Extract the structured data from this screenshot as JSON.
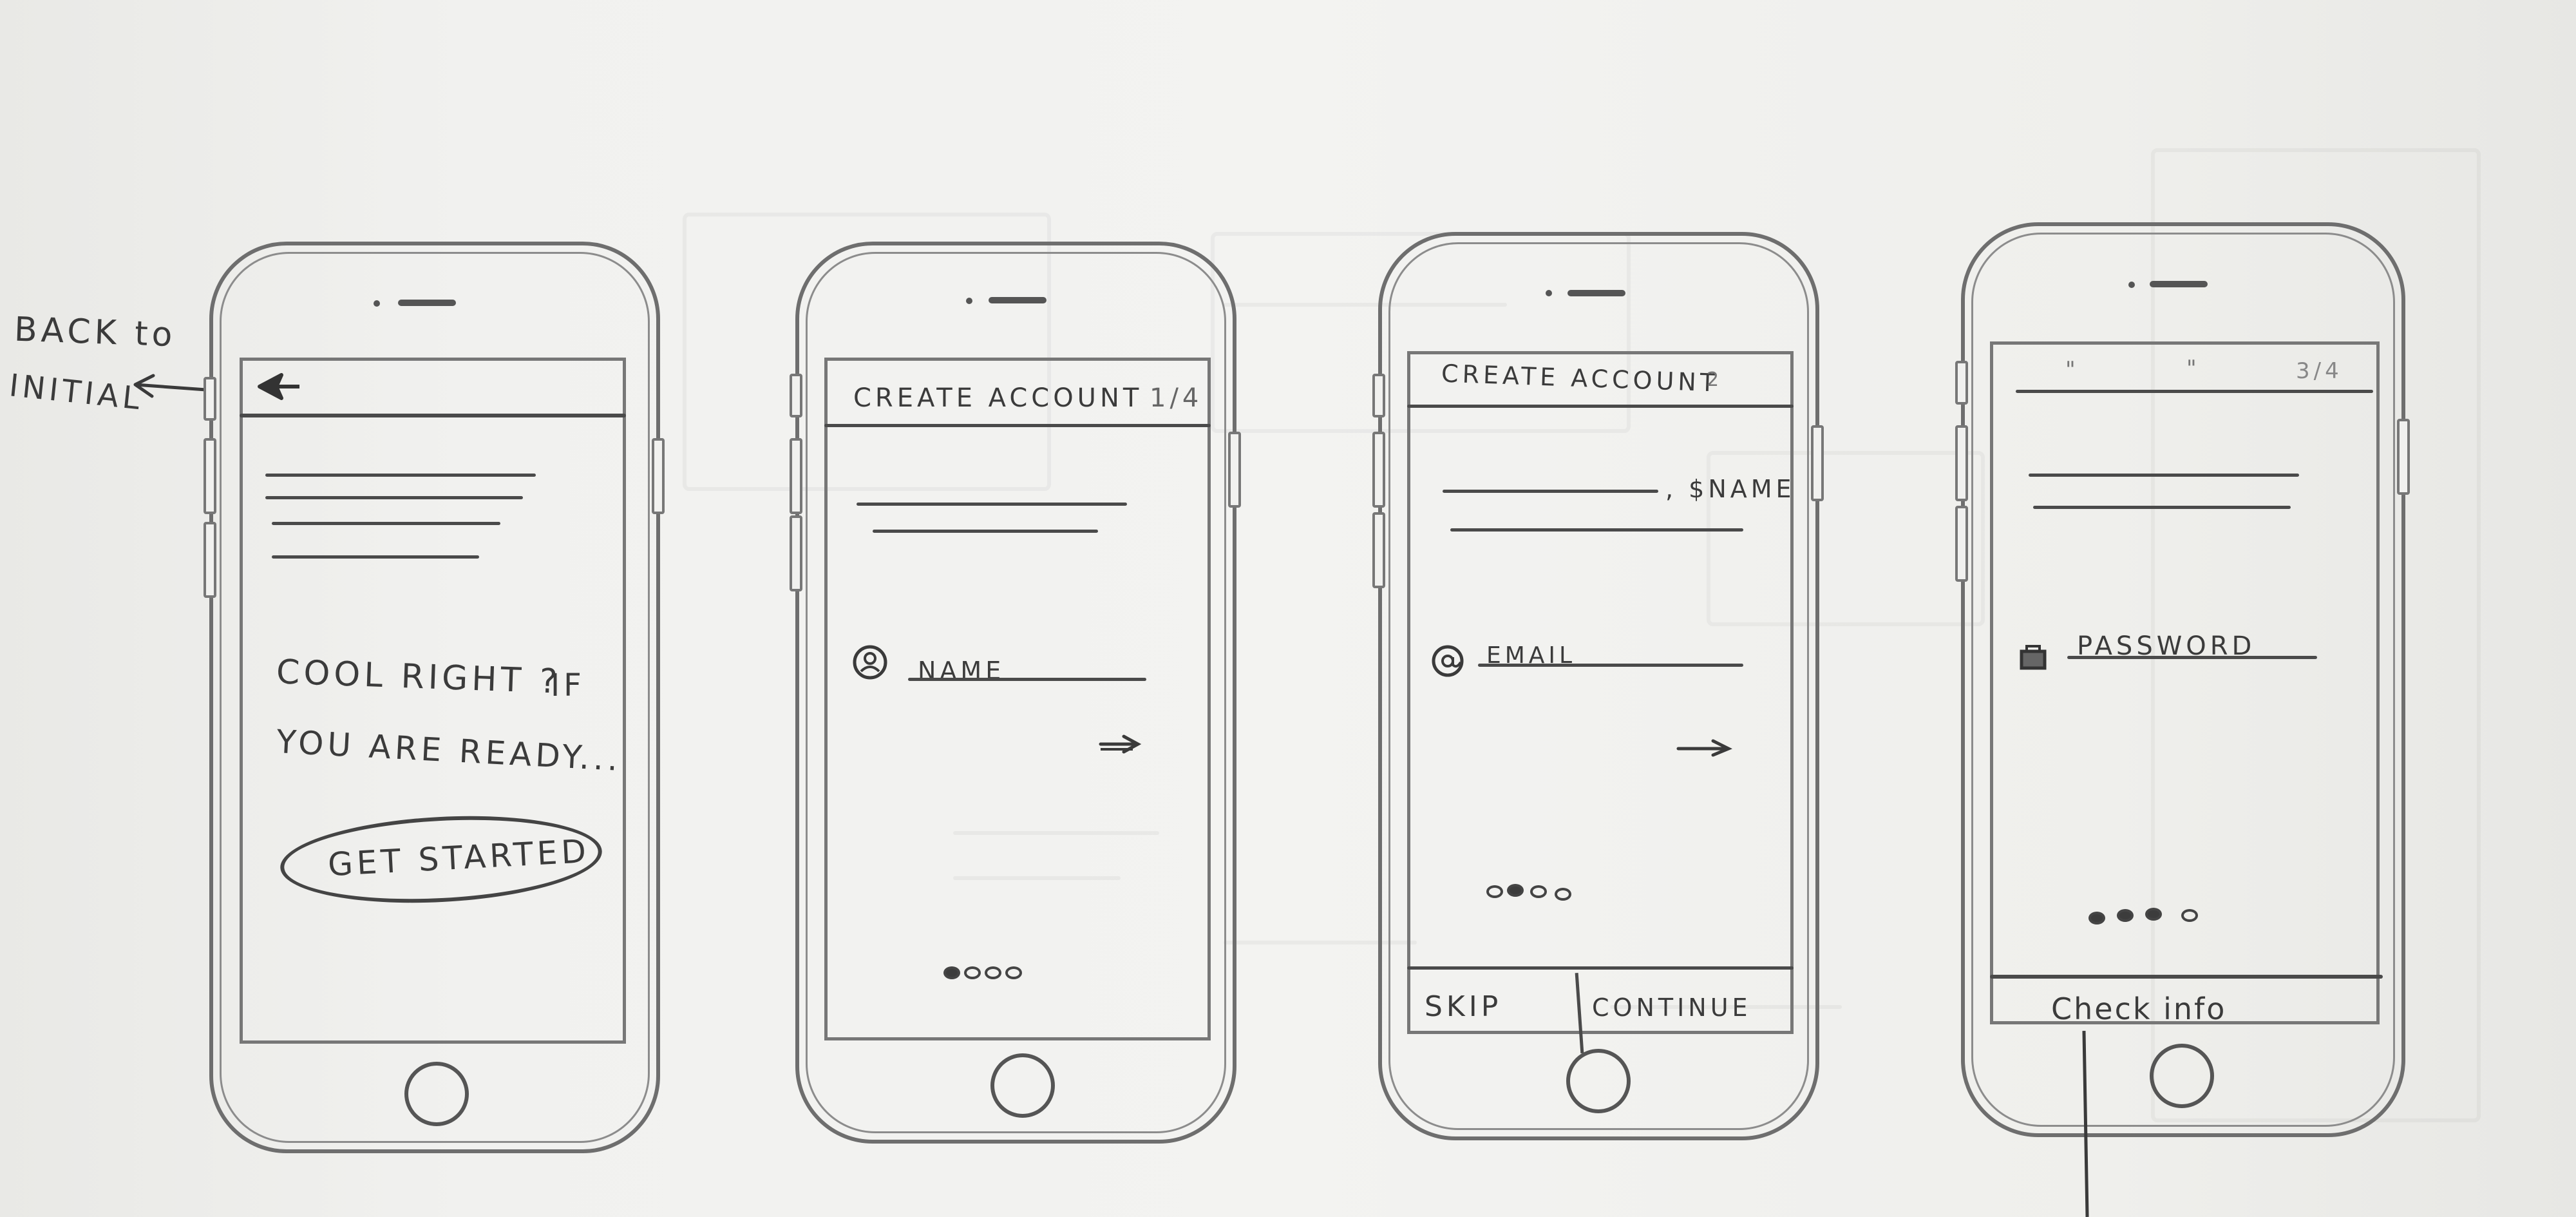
{
  "annotations": {
    "back_note_line1": "BACK to",
    "back_note_line2": "INITIAL"
  },
  "screens": [
    {
      "id": "intro",
      "headline_line1": "COOL RIGHT ?",
      "headline_if": "IF",
      "headline_line2": "YOU ARE READY...",
      "cta_label": "GET STARTED",
      "back_icon": "back-arrow-icon"
    },
    {
      "id": "name",
      "header": "CREATE ACCOUNT",
      "step": "1/4",
      "field_label": "NAME",
      "field_icon": "user-icon",
      "next_icon": "next-arrow-icon",
      "progress_current": 1,
      "progress_total": 4
    },
    {
      "id": "email",
      "header": "CREATE ACCOUNT",
      "step": "2",
      "greeting_suffix": ", $NAME",
      "field_label": "EMAIL",
      "field_icon": "at-sign-icon",
      "next_icon": "next-arrow-icon",
      "progress_current": 2,
      "progress_total": 4,
      "skip_label": "SKIP",
      "continue_label": "CONTINUE"
    },
    {
      "id": "password",
      "header_left": "\"",
      "header_mid": "\"",
      "step": "3/4",
      "field_label": "PASSWORD",
      "field_icon": "lock-icon",
      "progress_current": 3,
      "progress_total": 4,
      "footer_label": "Check info"
    }
  ]
}
